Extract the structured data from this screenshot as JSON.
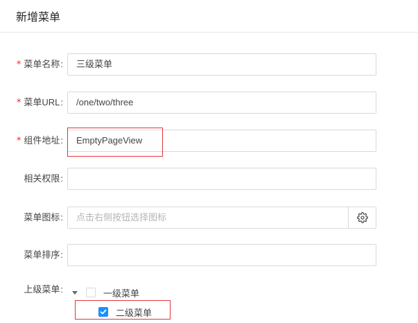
{
  "dialog": {
    "title": "新增菜单"
  },
  "form": {
    "menu_name": {
      "label": "菜单名称",
      "required": true,
      "value": "三级菜单"
    },
    "menu_url": {
      "label": "菜单URL",
      "required": true,
      "value": "/one/two/three"
    },
    "component": {
      "label": "组件地址",
      "required": true,
      "value": "EmptyPageView"
    },
    "permission": {
      "label": "相关权限",
      "required": false,
      "value": ""
    },
    "icon": {
      "label": "菜单图标",
      "required": false,
      "value": "",
      "placeholder": "点击右侧按钮选择图标",
      "button_icon": "gear-icon"
    },
    "order": {
      "label": "菜单排序",
      "required": false,
      "value": ""
    },
    "parent": {
      "label": "上级菜单",
      "tree": [
        {
          "label": "一级菜单",
          "checked": false,
          "expanded": true
        },
        {
          "label": "二级菜单",
          "checked": true
        }
      ]
    },
    "colon": ":",
    "required_mark": "*"
  },
  "colors": {
    "required": "#f5222d",
    "checkbox_checked": "#1890ff",
    "highlight_box": "#e0353b"
  }
}
